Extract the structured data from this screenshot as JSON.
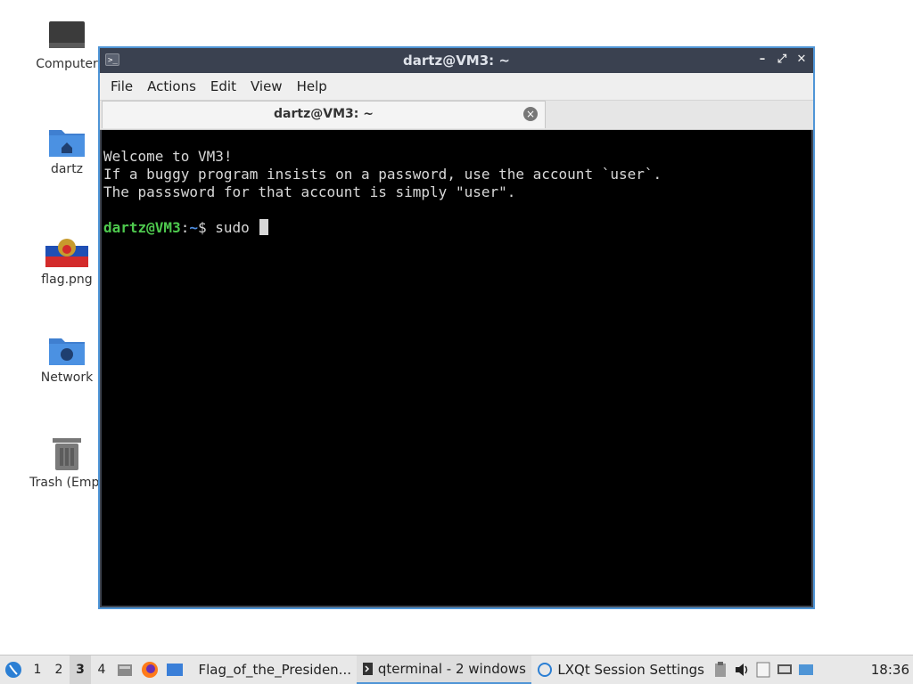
{
  "desktop": {
    "icons": [
      {
        "label": "Computer"
      },
      {
        "label": "dartz"
      },
      {
        "label": "flag.png"
      },
      {
        "label": "Network"
      },
      {
        "label": "Trash (Empt"
      }
    ]
  },
  "window": {
    "title": "dartz@VM3: ~",
    "controls": {
      "minimize": "–",
      "maximize": "⤢",
      "close": "✕"
    },
    "menu": [
      "File",
      "Actions",
      "Edit",
      "View",
      "Help"
    ],
    "tab": {
      "label": "dartz@VM3: ~",
      "close": "×"
    }
  },
  "terminal": {
    "lines": [
      "Welcome to VM3!",
      "If a buggy program insists on a password, use the account `user`.",
      "The passsword for that account is simply \"user\"."
    ],
    "prompt_user": "dartz@VM3",
    "prompt_sep": ":",
    "prompt_path": "~",
    "prompt_symbol": "$ ",
    "command": "sudo "
  },
  "taskbar": {
    "desktops": [
      "1",
      "2",
      "3",
      "4"
    ],
    "active_desktop": "3",
    "tasks": [
      {
        "label": "Flag_of_the_Presiden..."
      },
      {
        "label": "qterminal - 2 windows"
      },
      {
        "label": "LXQt Session Settings"
      }
    ],
    "clock": "18:36"
  },
  "colors": {
    "accent": "#4f95d6",
    "prompt_user": "#4ec94e",
    "prompt_path": "#4d8de0"
  }
}
